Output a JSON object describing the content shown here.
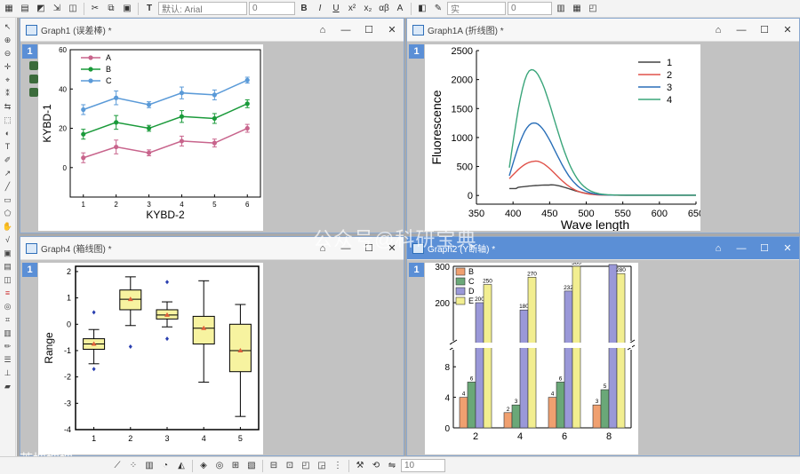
{
  "toolbar": {
    "font_name": "默认: Arial",
    "font_size": "0",
    "line_style": "实",
    "line_width": "0",
    "zoom": "10"
  },
  "windows": {
    "graph1": {
      "title": "Graph1 (误差棒) *",
      "layer": "1"
    },
    "graph1a": {
      "title": "Graph1A (折线图) *",
      "layer": "1"
    },
    "graph4": {
      "title": "Graph4 (箱线图) *",
      "layer": "1"
    },
    "graph2": {
      "title": "Graph2 (Y断轴) *",
      "layer": "1"
    }
  },
  "watermark": "公众号@科研宝典",
  "watermark2": "芮坤坤坤",
  "chart_data": [
    {
      "type": "line",
      "xlabel": "KYBD-2",
      "ylabel": "KYBD-1",
      "x": [
        1,
        2,
        3,
        4,
        5,
        6
      ],
      "xlim": [
        0.6,
        6.4
      ],
      "ylim": [
        -15,
        60
      ],
      "yticks": [
        0,
        20,
        40,
        60
      ],
      "series": [
        {
          "name": "A",
          "color": "#c8648c",
          "values": [
            5,
            10.5,
            7.5,
            13.5,
            12.5,
            20
          ],
          "errors": [
            2.5,
            3.5,
            1.5,
            2.5,
            2,
            2
          ]
        },
        {
          "name": "B",
          "color": "#1a9a3a",
          "values": [
            17,
            23,
            20,
            26,
            25,
            32.5
          ],
          "errors": [
            2.5,
            3.5,
            1.5,
            3,
            2.5,
            2
          ]
        },
        {
          "name": "C",
          "color": "#5a9ad8",
          "values": [
            29.5,
            35.5,
            32,
            38,
            37,
            44.5
          ],
          "errors": [
            2.5,
            3.5,
            1.5,
            3,
            2.5,
            1.5
          ]
        }
      ],
      "legend": "top-left"
    },
    {
      "type": "line",
      "xlabel": "Wave length",
      "ylabel": "Fluorescence",
      "xlim": [
        350,
        650
      ],
      "ylim": [
        -150,
        2500
      ],
      "xticks": [
        350,
        400,
        450,
        500,
        550,
        600,
        650
      ],
      "yticks": [
        0,
        500,
        1000,
        1500,
        2000,
        2500
      ],
      "series": [
        {
          "name": "1",
          "color": "#444444",
          "peak_x": 450,
          "peak_y": 180,
          "start_y": 120
        },
        {
          "name": "2",
          "color": "#e0524a",
          "peak_x": 430,
          "peak_y": 590,
          "start_y": 290
        },
        {
          "name": "3",
          "color": "#2a6fb8",
          "peak_x": 428,
          "peak_y": 1250,
          "start_y": 340
        },
        {
          "name": "4",
          "color": "#3aa57a",
          "peak_x": 425,
          "peak_y": 2170,
          "start_y": 480
        }
      ],
      "legend": "top-right"
    },
    {
      "type": "box",
      "ylabel": "Range",
      "categories": [
        "1",
        "2",
        "3",
        "4",
        "5"
      ],
      "ylim": [
        -4,
        2.2
      ],
      "yticks": [
        -4,
        -3,
        -2,
        -1,
        0,
        1,
        2
      ],
      "boxes": [
        {
          "q1": -0.95,
          "median": -0.75,
          "q3": -0.55,
          "whisker_low": -1.5,
          "whisker_high": -0.2,
          "mean": -0.75,
          "outliers": [
            0.45,
            -1.7
          ]
        },
        {
          "q1": 0.55,
          "median": 0.95,
          "q3": 1.3,
          "whisker_low": -0.05,
          "whisker_high": 1.8,
          "mean": 0.95,
          "outliers": [
            -0.85
          ]
        },
        {
          "q1": 0.2,
          "median": 0.35,
          "q3": 0.55,
          "whisker_low": -0.1,
          "whisker_high": 0.85,
          "mean": 0.35,
          "outliers": [
            1.6,
            -0.55
          ]
        },
        {
          "q1": -0.75,
          "median": -0.15,
          "q3": 0.3,
          "whisker_low": -2.2,
          "whisker_high": 1.65,
          "mean": -0.15,
          "outliers": []
        },
        {
          "q1": -1.8,
          "median": -1.0,
          "q3": 0.0,
          "whisker_low": -3.5,
          "whisker_high": 0.75,
          "mean": -1.0,
          "outliers": []
        }
      ]
    },
    {
      "type": "bar",
      "x": [
        "2",
        "4",
        "6",
        "8"
      ],
      "upper_ylim": [
        100,
        300
      ],
      "upper_yticks": [
        200,
        300
      ],
      "lower_ylim": [
        0,
        10
      ],
      "lower_yticks": [
        0,
        4,
        8
      ],
      "series": [
        {
          "name": "B",
          "color": "#f0a070",
          "values": [
            4,
            2,
            4,
            3
          ]
        },
        {
          "name": "C",
          "color": "#6aa878",
          "values": [
            6,
            3,
            6,
            5
          ]
        },
        {
          "name": "D",
          "color": "#9a98d8",
          "values": [
            200,
            180,
            232,
            305
          ]
        },
        {
          "name": "E",
          "color": "#f2ee90",
          "values": [
            250,
            270,
            300,
            280
          ]
        }
      ],
      "legend": "top-left"
    }
  ]
}
